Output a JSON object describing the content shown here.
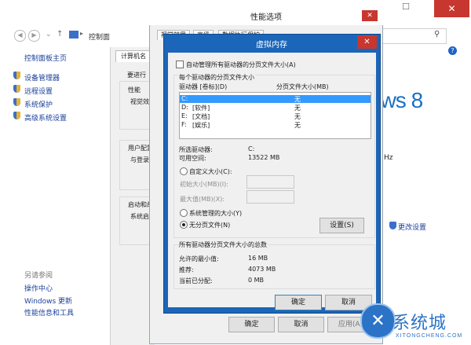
{
  "system_window": {
    "nav_path": "控制面",
    "left_links": [
      "控制面板主页",
      "设备管理器",
      "远程设置",
      "系统保护",
      "高级系统设置"
    ],
    "see_also_label": "另请参阅",
    "see_also_links": [
      "操作中心",
      "Windows 更新",
      "性能信息和工具"
    ],
    "logo_text": "ows 8",
    "hz_text": "Hz",
    "change_settings": "更改设置"
  },
  "system_properties": {
    "tab_computer_name": "计算机名",
    "text_requires": "要进行",
    "text_performance": "性能",
    "text_visual": "视觉效",
    "text_profiles": "用户配置",
    "text_logon": "与登录",
    "text_startup": "启动和故",
    "text_system_start": "系统启"
  },
  "performance_options": {
    "title": "性能选项",
    "tabs": [
      "视觉效果",
      "高级",
      "数据执行保护"
    ],
    "ok": "确定",
    "cancel": "取消",
    "apply": "应用(A)"
  },
  "virtual_memory": {
    "title": "虚拟内存",
    "auto_manage_label": "自动管理所有驱动器的分页文件大小(A)",
    "per_drive_label": "每个驱动器的分页文件大小",
    "col_drive": "驱动器 [卷标](D)",
    "col_size": "分页文件大小(MB)",
    "drives": [
      {
        "letter": "C:",
        "label": "",
        "size": "无",
        "selected": true
      },
      {
        "letter": "D:",
        "label": "[软件]",
        "size": "无",
        "selected": false
      },
      {
        "letter": "E:",
        "label": "[文档]",
        "size": "无",
        "selected": false
      },
      {
        "letter": "F:",
        "label": "[娱乐]",
        "size": "无",
        "selected": false
      }
    ],
    "selected_drive_label": "所选驱动器:",
    "selected_drive_value": "C:",
    "free_space_label": "可用空间:",
    "free_space_value": "13522 MB",
    "custom_size_label": "自定义大小(C):",
    "initial_size_label": "初始大小(MB)(I):",
    "max_size_label": "最大值(MB)(X):",
    "system_managed_label": "系统管理的大小(Y)",
    "no_paging_label": "无分页文件(N)",
    "set_button": "设置(S)",
    "total_label": "所有驱动器分页文件大小的总数",
    "min_allowed_label": "允许的最小值:",
    "min_allowed_value": "16 MB",
    "recommended_label": "推荐:",
    "recommended_value": "4073 MB",
    "allocated_label": "当前已分配:",
    "allocated_value": "0 MB",
    "ok": "确定",
    "cancel": "取消",
    "selected_option": "no_paging"
  },
  "watermark": {
    "text": "系统城",
    "sub": "XITONGCHENG.COM"
  },
  "colors": {
    "vm_frame": "#1b66b8",
    "close_red": "#c7372f",
    "selection": "#3399ff",
    "link": "#1a3f9b"
  }
}
